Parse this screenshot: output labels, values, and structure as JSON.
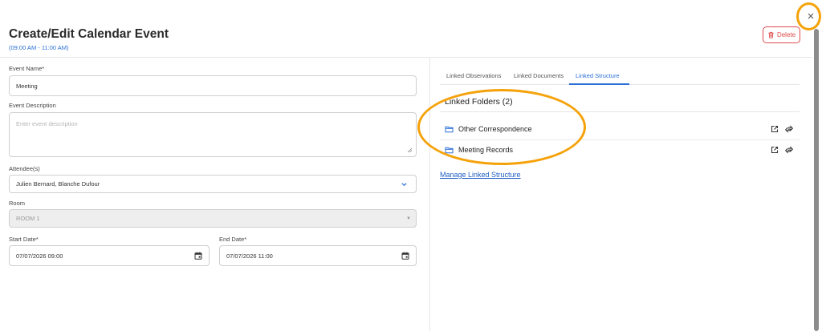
{
  "header": {
    "title": "Create/Edit Calendar Event",
    "time_range": "(09:00 AM - 11:00 AM)",
    "delete_label": "Delete",
    "close_glyph": "×"
  },
  "form": {
    "event_name": {
      "label": "Event Name*",
      "value": "Meeting"
    },
    "event_description": {
      "label": "Event Description",
      "placeholder": "Enter event description"
    },
    "attendees": {
      "label": "Attendee(s)",
      "value": "Julien Bernard, Blanche Dufour"
    },
    "room": {
      "label": "Room",
      "value": "ROOM 1"
    },
    "start_date": {
      "label": "Start Date*",
      "value": "07/07/2026 09:00"
    },
    "end_date": {
      "label": "End Date*",
      "value": "07/07/2026 11:00"
    }
  },
  "tabs": [
    {
      "label": "Linked Observations",
      "active": false
    },
    {
      "label": "Linked Documents",
      "active": false
    },
    {
      "label": "Linked Structure",
      "active": true
    }
  ],
  "linked_folders": {
    "heading": "Linked Folders (2)",
    "items": [
      {
        "name": "Other Correspondence"
      },
      {
        "name": "Meeting Records"
      }
    ],
    "manage_label": "Manage Linked Structure"
  },
  "colors": {
    "accent": "#2b6fd6",
    "danger": "#e04a4a",
    "highlight": "#f5a20a"
  },
  "icons": [
    "close-icon",
    "trash-icon",
    "chevron-down-icon",
    "calendar-icon",
    "folder-icon",
    "open-external-icon",
    "unlink-icon"
  ]
}
